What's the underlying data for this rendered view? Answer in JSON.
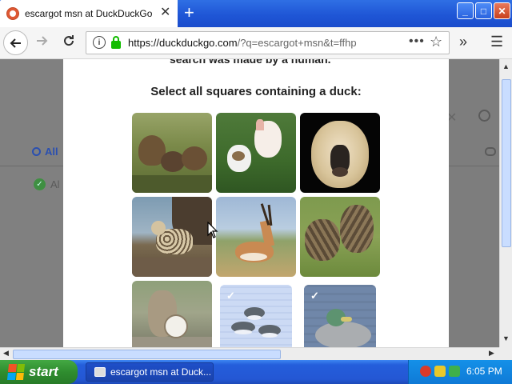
{
  "browser": {
    "tab_title": "escargot msn at DuckDuckGo",
    "tab_close": "✕",
    "new_tab": "+",
    "url_host": "https://duckduckgo.com",
    "url_path": "/?q=escargot+msn&t=ffhp",
    "window_controls": [
      "_",
      "□",
      "✕"
    ]
  },
  "page_background": {
    "tab_all_label": "All",
    "filter_label": "Al"
  },
  "captcha": {
    "top_text": "search was made by a human.",
    "heading": "Select all squares containing a duck:",
    "tiles": [
      {
        "name": "ducks-in-grass",
        "selected": false
      },
      {
        "name": "dogs-on-lawn",
        "selected": false
      },
      {
        "name": "white-faced-monkey",
        "selected": false
      },
      {
        "name": "serval-cat",
        "selected": false
      },
      {
        "name": "gazelle",
        "selected": false
      },
      {
        "name": "two-cats",
        "selected": false
      },
      {
        "name": "kitten-with-cat",
        "selected": false
      },
      {
        "name": "ducks-on-water",
        "selected": true
      },
      {
        "name": "mallard-duck",
        "selected": true
      }
    ],
    "check_mark": "✓"
  },
  "taskbar": {
    "start_label": "start",
    "window_button": "escargot msn at Duck...",
    "clock": "6:05 PM"
  },
  "colors": {
    "accent": "#de5833",
    "titlebar": "#1f56d6",
    "taskbar": "#245edb",
    "start": "#2f8d2f",
    "lock": "#12bc00"
  }
}
